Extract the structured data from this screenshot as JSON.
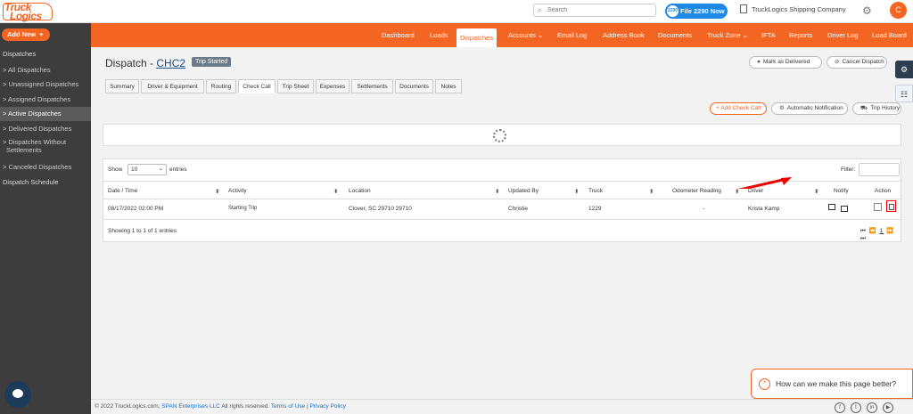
{
  "header": {
    "logo_line1": "Truck",
    "logo_line2": "Logics",
    "search_placeholder": "Search",
    "file2290_label": "File 2290 Now",
    "file2290_badge": "2290",
    "company_name": "TruckLogics Shipping Company",
    "avatar_letter": "C"
  },
  "sidebar": {
    "add_new": "Add New",
    "add_new_icon": "+",
    "section_title": "Dispatches",
    "items": [
      {
        "label": "> All Dispatches"
      },
      {
        "label": "> Unassigned Dispatches"
      },
      {
        "label": "> Assigned Dispatches"
      },
      {
        "label": "> Active Dispatches"
      },
      {
        "label": "> Delivered Dispatches"
      },
      {
        "label": "> Dispatches Without"
      },
      {
        "label": "Settlements"
      },
      {
        "label": "> Canceled Dispatches"
      }
    ],
    "schedule": "Dispatch Schedule"
  },
  "nav": {
    "items": [
      {
        "label": "Dashboard"
      },
      {
        "label": "Loads"
      },
      {
        "label": "Dispatches"
      },
      {
        "label": "Accounts ⌄"
      },
      {
        "label": "Email Log"
      },
      {
        "label": "Address Book"
      },
      {
        "label": "Documents"
      },
      {
        "label": "Truck Zone ⌄"
      },
      {
        "label": "IFTA"
      },
      {
        "label": "Reports"
      },
      {
        "label": "Driver Log"
      },
      {
        "label": "Load Board"
      }
    ]
  },
  "page": {
    "title_prefix": "Dispatch - ",
    "title_link": "CHC2",
    "status_badge": "Trip Started",
    "mark_delivered": "Mark as Delivered",
    "cancel_dispatch": "Cancel Dispatch",
    "mark_delivered_icon": "●",
    "cancel_icon": "⊘"
  },
  "tabs": [
    {
      "label": "Summary"
    },
    {
      "label": "Driver & Equipment"
    },
    {
      "label": "Routing"
    },
    {
      "label": "Check Call"
    },
    {
      "label": "Trip Sheet"
    },
    {
      "label": "Expenses"
    },
    {
      "label": "Settlements"
    },
    {
      "label": "Documents"
    },
    {
      "label": "Notes"
    }
  ],
  "actions": {
    "add_check_call": "+ Add Check Call",
    "auto_notification": "Automatic Notification",
    "auto_notification_icon": "⚙",
    "trip_history": "Trip History",
    "trip_history_icon": "⛟"
  },
  "table": {
    "show_label": "Show",
    "page_size": "10",
    "entries_label": "entries",
    "filter_label": "Filter:",
    "columns": [
      "Date / Time",
      "Activity",
      "Location",
      "Updated By",
      "Truck",
      "Odometer Reading",
      "Driver",
      "Notify",
      "Action"
    ],
    "sort_glyph": "⬍",
    "rows": [
      {
        "date_time": "08/17/2022 02:00 PM",
        "activity": "Starting Trip",
        "location": "Clover, SC 29710 29710",
        "updated_by": "Christie",
        "truck": "1229",
        "odometer": "-",
        "driver": "Krista Kamp"
      }
    ],
    "info": "Showing 1 to 1 of 1 entries",
    "pager": {
      "first": "⏮",
      "prev": "⏪",
      "current": "1",
      "next": "⏩",
      "last": "⏭"
    }
  },
  "feedback": {
    "label": "How can we make this page better?",
    "icon": "⌃"
  },
  "footer": {
    "copyright": "© 2022 TruckLogics.com, ",
    "span": "SPAN Enterprises LLC",
    "rights": " All rights reserved. ",
    "terms": "Terms of Use",
    "sep": " | ",
    "privacy": "Privacy Policy",
    "social": [
      "f",
      "t",
      "in",
      "▶"
    ]
  },
  "widgets": {
    "gear": "⚙",
    "doc": "☷"
  },
  "colors": {
    "brand": "#f26522",
    "sidebar": "#3d3d3d",
    "link": "#1a4e8a",
    "delete_highlight": "#e00000"
  }
}
